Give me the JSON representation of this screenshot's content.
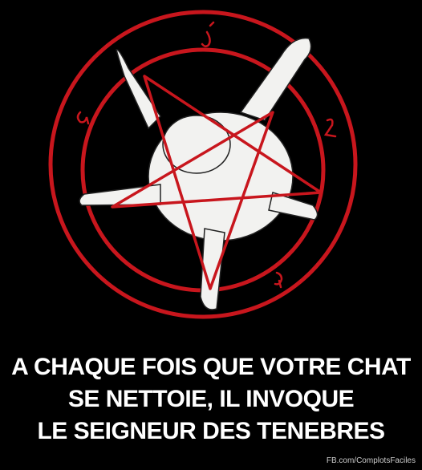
{
  "caption": {
    "line1": "A CHAQUE FOIS QUE VOTRE CHAT",
    "line2": "SE NETTOIE, IL INVOQUE",
    "line3": "LE SEIGNEUR DES TENEBRES"
  },
  "credit": "FB.com/ComplotsFaciles",
  "illustration": {
    "subject": "cat-in-pentagram",
    "ring_color": "#c8161d",
    "cat_fill": "#f2f2f0",
    "background": "#000000"
  }
}
